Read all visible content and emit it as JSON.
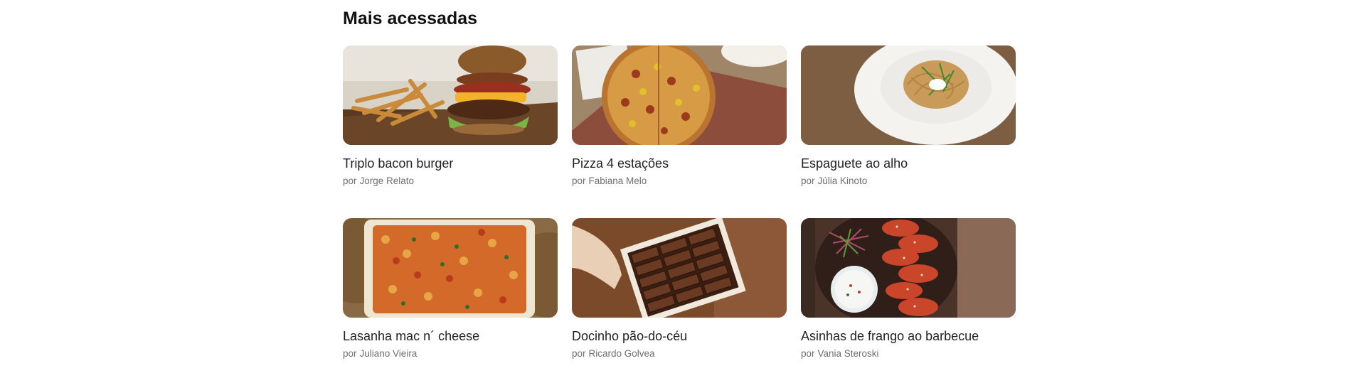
{
  "section": {
    "title": "Mais acessadas"
  },
  "author_prefix": "por",
  "recipes": [
    {
      "title": "Triplo bacon burger",
      "author": "Jorge Relato",
      "image": "burger-with-fries-photo"
    },
    {
      "title": "Pizza 4 estações",
      "author": "Fabiana Melo",
      "image": "pizza-photo"
    },
    {
      "title": "Espaguete ao alho",
      "author": "Júlia Kinoto",
      "image": "spaghetti-plate-photo"
    },
    {
      "title": "Lasanha mac n´ cheese",
      "author": "Juliano Vieira",
      "image": "baked-macaroni-dish-photo"
    },
    {
      "title": "Docinho pão-do-céu",
      "author": "Ricardo Golvea",
      "image": "chocolate-box-photo"
    },
    {
      "title": "Asinhas de frango ao barbecue",
      "author": "Vania Steroski",
      "image": "bbq-chicken-wings-photo"
    }
  ]
}
